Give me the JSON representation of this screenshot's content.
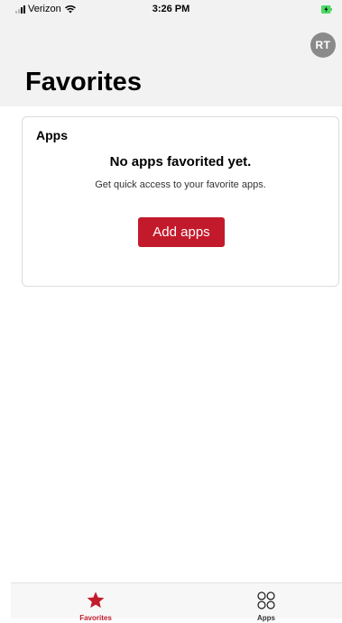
{
  "status_bar": {
    "carrier": "Verizon",
    "time": "3:26 PM",
    "signal_icon": "signal-bars-icon",
    "wifi_icon": "wifi-icon",
    "battery_icon": "battery-charging-icon"
  },
  "header": {
    "avatar_initials": "RT",
    "title": "Favorites"
  },
  "apps_card": {
    "title": "Apps",
    "empty_title": "No apps favorited yet.",
    "empty_subtitle": "Get quick access to your favorite apps.",
    "add_button_label": "Add apps"
  },
  "tab_bar": {
    "tabs": [
      {
        "label": "Favorites",
        "icon": "star-icon",
        "active": true
      },
      {
        "label": "Apps",
        "icon": "apps-grid-icon",
        "active": false
      }
    ]
  },
  "colors": {
    "accent": "#c31a2b",
    "header_bg": "#f2f2f2",
    "avatar_bg": "#8a8a8a",
    "battery": "#4cd964"
  }
}
